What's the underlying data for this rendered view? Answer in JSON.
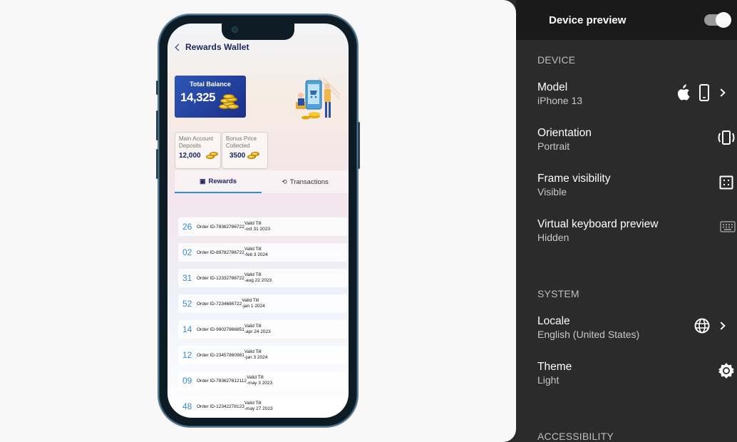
{
  "phone_app": {
    "title": "Rewards Wallet",
    "balance": {
      "label": "Total Balance",
      "amount": "14,325"
    },
    "stats": [
      {
        "label": "Main Account Deposits",
        "value": "12,000"
      },
      {
        "label": "Bonus Price Collected",
        "value": "3500"
      }
    ],
    "tabs": [
      {
        "label": "Rewards",
        "icon": "gift-icon"
      },
      {
        "label": "Transactions",
        "icon": "swap-icon"
      }
    ],
    "rows": [
      {
        "num": "26",
        "order": "Order ID-78362786722",
        "valid_label": "Valid Till",
        "valid_date": "-oct 31 2023"
      },
      {
        "num": "02",
        "order": "Order ID-89782786722",
        "valid_label": "Valid Till",
        "valid_date": "-feb 3 2024"
      },
      {
        "num": "31",
        "order": "Order ID-12332786722",
        "valid_label": "Valid Till",
        "valid_date": "-aug 22 2023"
      },
      {
        "num": "52",
        "order": "Order ID-7234686722",
        "valid_label": "Valid Till",
        "valid_date": "-jan 1 2024"
      },
      {
        "num": "14",
        "order": "Order ID-99027866851",
        "valid_label": "Valid Till",
        "valid_date": "-apr 24 2023"
      },
      {
        "num": "12",
        "order": "Order ID-23457860981",
        "valid_label": "Valid Till",
        "valid_date": "-jan 3 2024"
      },
      {
        "num": "09",
        "order": "Order ID-783627812112",
        "valid_label": "Valid Till",
        "valid_date": "-may 3 2023"
      },
      {
        "num": "48",
        "order": "Order ID-12342278123",
        "valid_label": "Valid Till",
        "valid_date": "-may 27 2023"
      }
    ]
  },
  "panel": {
    "title": "Device preview",
    "toggle_on": true,
    "device_section": "DEVICE",
    "model": {
      "name": "Model",
      "value": "iPhone 13"
    },
    "orientation": {
      "name": "Orientation",
      "value": "Portrait"
    },
    "frame": {
      "name": "Frame visibility",
      "value": "Visible"
    },
    "keyboard": {
      "name": "Virtual keyboard preview",
      "value": "Hidden"
    },
    "system_section": "SYSTEM",
    "locale": {
      "name": "Locale",
      "value": "English (United States)"
    },
    "theme": {
      "name": "Theme",
      "value": "Light"
    },
    "accessibility_section": "ACCESSIBILITY"
  }
}
